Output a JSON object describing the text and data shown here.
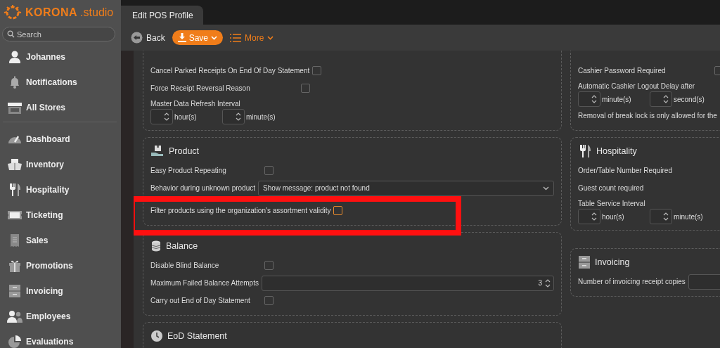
{
  "logo": {
    "brand": "KORONA",
    "suffix": ".studio"
  },
  "search": {
    "placeholder": "Search"
  },
  "sidebar": {
    "groups": [
      [
        {
          "label": "Johannes"
        },
        {
          "label": "Notifications"
        },
        {
          "label": "All Stores"
        }
      ],
      [
        {
          "label": "Dashboard"
        },
        {
          "label": "Inventory"
        },
        {
          "label": "Hospitality"
        },
        {
          "label": "Ticketing"
        },
        {
          "label": "Sales"
        },
        {
          "label": "Promotions"
        },
        {
          "label": "Invoicing"
        },
        {
          "label": "Employees"
        },
        {
          "label": "Evaluations"
        }
      ]
    ]
  },
  "tabs": [
    {
      "label": "Edit POS Profile",
      "selected": true
    }
  ],
  "toolbar": {
    "back": "Back",
    "save": "Save",
    "more": "More"
  },
  "columns": [
    [
      {
        "rows": [
          {
            "kind": "checkbox",
            "label": "Cancel Parked Receipts On End Of Day Statement",
            "checked": false,
            "highlighted": false
          },
          {
            "kind": "checkbox",
            "label": "Force Receipt Reversal Reason",
            "checked": false,
            "highlighted": false
          },
          {
            "kind": "interval",
            "label": "Master Data Refresh Interval",
            "units": [
              "hour(s)",
              "minute(s)"
            ]
          }
        ]
      },
      {
        "title": "Product",
        "rows": [
          {
            "kind": "checkbox",
            "label": "Easy Product Repeating",
            "checked": false,
            "highlighted": false
          },
          {
            "kind": "select",
            "label": "Behavior during unknown product",
            "value": "Show message: product not found"
          },
          {
            "kind": "checkbox",
            "label": "Filter products using the organization's assortment validity",
            "checked": false,
            "highlighted": true
          }
        ]
      },
      {
        "title": "Balance",
        "rows": [
          {
            "kind": "checkbox",
            "label": "Disable Blind Balance",
            "checked": false,
            "highlighted": false
          },
          {
            "kind": "number",
            "label": "Maximum Failed Balance Attempts",
            "value": "3"
          },
          {
            "kind": "checkbox",
            "label": "Carry out End of Day Statement",
            "checked": false,
            "highlighted": false
          }
        ]
      },
      {
        "title": "EoD Statement"
      }
    ],
    [
      {
        "rows": [
          {
            "kind": "checkbox",
            "label": "Cashier Password Required",
            "checked": false,
            "highlighted": false
          },
          {
            "kind": "interval",
            "label": "Automatic Cashier Logout Delay after",
            "units": [
              "minute(s)",
              "second(s)"
            ]
          },
          {
            "kind": "text",
            "label": "Removal of break lock is only allowed for the"
          }
        ]
      },
      {
        "title": "Hospitality",
        "rows": [
          {
            "kind": "text",
            "label": "Order/Table Number Required"
          },
          {
            "kind": "text",
            "label": "Guest count required"
          },
          {
            "kind": "interval",
            "label": "Table Service Interval",
            "units": [
              "hour(s)",
              "minute(s)"
            ]
          }
        ]
      },
      {
        "title": "Invoicing",
        "rows": [
          {
            "kind": "field",
            "label": "Number of invoicing receipt copies"
          }
        ]
      }
    ]
  ]
}
